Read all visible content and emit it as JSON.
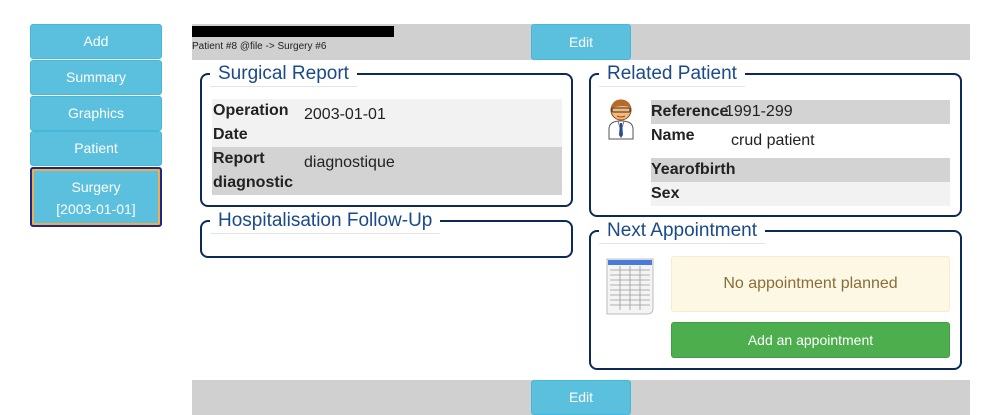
{
  "sidebar": {
    "add": "Add",
    "summary": "Summary",
    "graphics": "Graphics",
    "patient": "Patient",
    "surgery_line1": "Surgery",
    "surgery_line2": "[2003-01-01]"
  },
  "header": {
    "breadcrumb": "Patient #8 @file -> Surgery #6",
    "edit_label": "Edit"
  },
  "surgical_report": {
    "title": "Surgical Report",
    "rows": [
      {
        "label_line1": "Operation",
        "label_line2": "Date",
        "value": "2003-01-01"
      },
      {
        "label_line1": "Report",
        "label_line2": "diagnostic",
        "value": "diagnostique"
      }
    ]
  },
  "hospitalisation": {
    "title": "Hospitalisation Follow-Up"
  },
  "related_patient": {
    "title": "Related Patient",
    "icon": "doctor-icon",
    "rows": [
      {
        "label": "Reference",
        "value": "1991-299"
      },
      {
        "label": "Name",
        "value": "crud patient"
      },
      {
        "label": "Yearofbirth",
        "value": ""
      },
      {
        "label": "Sex",
        "value": ""
      }
    ]
  },
  "next_appointment": {
    "title": "Next Appointment",
    "icon": "spreadsheet-icon",
    "message": "No appointment planned",
    "add_label": "Add an appointment"
  },
  "footer": {
    "edit_label": "Edit"
  },
  "colors": {
    "info": "#5bc0de",
    "success": "#4cae4c",
    "panel_border": "#0b2a5a",
    "legend_text": "#1a4a8a",
    "warning_bg": "#fcf8e3",
    "bar_bg": "#d0d0d0"
  }
}
